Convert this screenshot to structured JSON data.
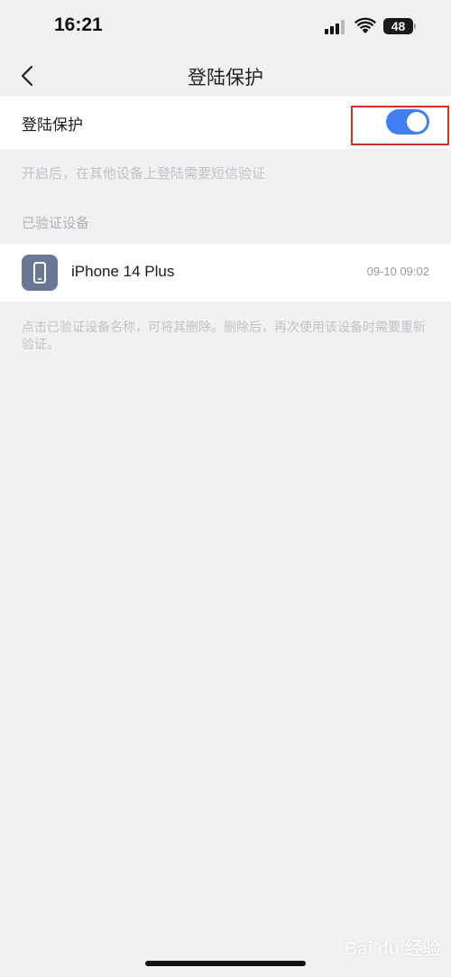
{
  "status_bar": {
    "time": "16:21",
    "battery": "48"
  },
  "nav": {
    "title": "登陆保护"
  },
  "protection": {
    "label": "登陆保护",
    "enabled": true,
    "hint": "开启后，在其他设备上登陆需要短信验证"
  },
  "verified_devices": {
    "section_title": "已验证设备",
    "items": [
      {
        "name": "iPhone 14 Plus",
        "time": "09-10 09:02",
        "icon": "phone-icon"
      }
    ],
    "note": "点击已验证设备名称，可将其删除。删除后，再次使用该设备时需要重新验证。"
  },
  "watermark": "Bai du 经验",
  "colors": {
    "accent": "#3f7ff2",
    "highlight": "#d6302a",
    "device_icon_bg": "#6a7795",
    "background": "#f1f1f3"
  }
}
